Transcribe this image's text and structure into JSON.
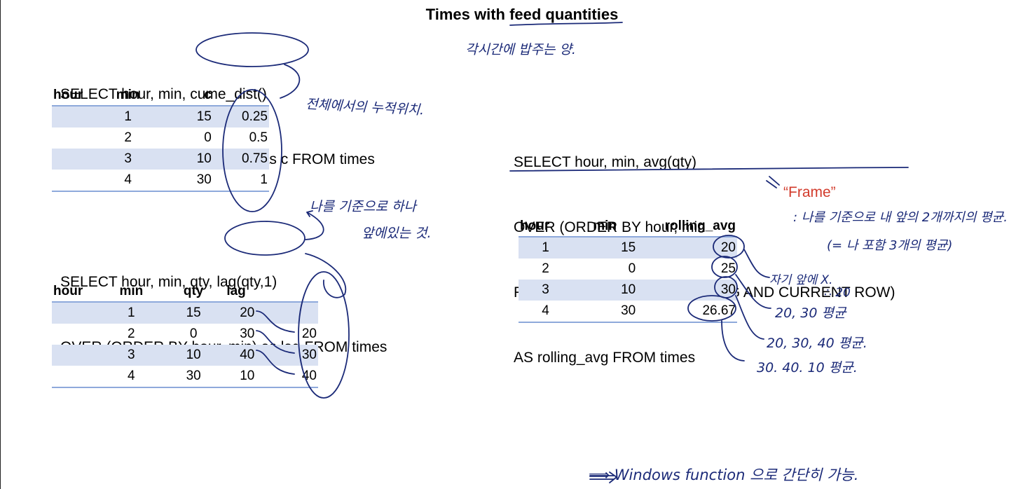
{
  "title": "Times with feed quantities",
  "top_note": "각시간에 밥주는 양.",
  "cume": {
    "sql": [
      "SELECT hour, min, cume_dist()",
      "OVER (ORDER BY hour, min) as c FROM times"
    ],
    "headers": [
      "hour",
      "min",
      "c"
    ],
    "rows": [
      [
        "1",
        "15",
        "0.25"
      ],
      [
        "2",
        "0",
        "0.5"
      ],
      [
        "3",
        "10",
        "0.75"
      ],
      [
        "4",
        "30",
        "1"
      ]
    ],
    "note": "전체에서의 누적위치."
  },
  "lag": {
    "sql": [
      "SELECT hour, min, qty, lag(qty,1)",
      "OVER (ORDER BY hour, min) as lag FROM times"
    ],
    "headers": [
      "hour",
      "min",
      "qty",
      "lag"
    ],
    "rows": [
      [
        "1",
        "15",
        "20",
        ""
      ],
      [
        "2",
        "0",
        "30",
        "20"
      ],
      [
        "3",
        "10",
        "40",
        "30"
      ],
      [
        "4",
        "30",
        "10",
        "40"
      ]
    ],
    "note": [
      "나를 기준으로 하나",
      "앞에있는 것."
    ]
  },
  "rolling": {
    "sql": [
      "SELECT hour, min, avg(qty)",
      "OVER (ORDER BY hour, min",
      "ROWS BETWEEN 2 PRECEDING AND CURRENT ROW)",
      "AS rolling_avg FROM times"
    ],
    "headers": [
      "hour",
      "min",
      "rolling_avg"
    ],
    "rows": [
      [
        "1",
        "15",
        "20"
      ],
      [
        "2",
        "0",
        "25"
      ],
      [
        "3",
        "10",
        "30"
      ],
      [
        "4",
        "30",
        "26.67"
      ]
    ],
    "frame_label": "“Frame”",
    "frame_note": [
      ": 나를 기준으로 내 앞의 2개까지의 평균.",
      "(= 나 포함 3개의 평균)"
    ],
    "row_notes": [
      "자기 앞에 X.",
      "∴ 20",
      "20, 30 평균",
      "20, 30, 40 평균.",
      "30. 40. 10 평균."
    ]
  },
  "bottom_note": "⟹ Windows function 으로 간단히 가능."
}
